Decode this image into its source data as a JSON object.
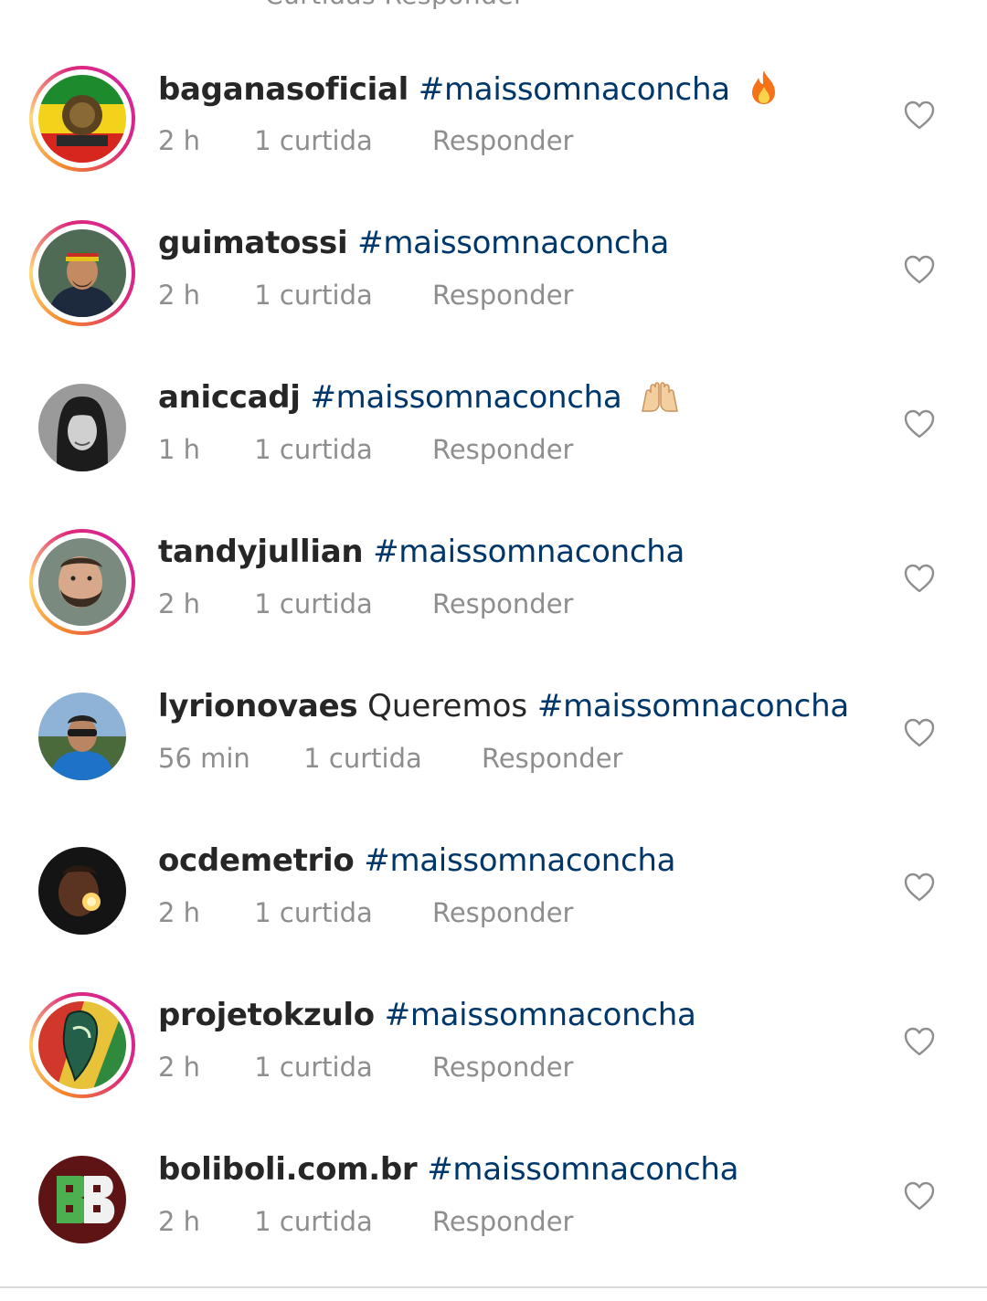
{
  "top_cut": {
    "text": "Curtidas    Responder"
  },
  "comments": [
    {
      "username": "baganasoficial",
      "text": "",
      "hashtag": "#maissomnaconcha",
      "emoji": "fire-emoji",
      "time": "2 h",
      "likes": "1 curtida",
      "reply": "Responder",
      "story_ring": true
    },
    {
      "username": "guimatossi",
      "text": "",
      "hashtag": "#maissomnaconcha",
      "emoji": "",
      "time": "2 h",
      "likes": "1 curtida",
      "reply": "Responder",
      "story_ring": true
    },
    {
      "username": "aniccadj",
      "text": "",
      "hashtag": "#maissomnaconcha",
      "emoji": "raising-hands-emoji",
      "time": "1 h",
      "likes": "1 curtida",
      "reply": "Responder",
      "story_ring": false
    },
    {
      "username": "tandyjullian",
      "text": "",
      "hashtag": "#maissomnaconcha",
      "emoji": "",
      "time": "2 h",
      "likes": "1 curtida",
      "reply": "Responder",
      "story_ring": true
    },
    {
      "username": "lyrionovaes",
      "text": "Queremos",
      "hashtag": "#maissomnaconcha",
      "emoji": "",
      "time": "56 min",
      "likes": "1 curtida",
      "reply": "Responder",
      "story_ring": false
    },
    {
      "username": "ocdemetrio",
      "text": "",
      "hashtag": "#maissomnaconcha",
      "emoji": "",
      "time": "2 h",
      "likes": "1 curtida",
      "reply": "Responder",
      "story_ring": false
    },
    {
      "username": "projetokzulo",
      "text": "",
      "hashtag": "#maissomnaconcha",
      "emoji": "",
      "time": "2 h",
      "likes": "1 curtida",
      "reply": "Responder",
      "story_ring": true
    },
    {
      "username": "boliboli.com.br",
      "text": "",
      "hashtag": "#maissomnaconcha",
      "emoji": "",
      "time": "2 h",
      "likes": "1 curtida",
      "reply": "Responder",
      "story_ring": false
    }
  ],
  "colors": {
    "username": "#262626",
    "hashtag": "#00376b",
    "meta": "#8e8e8e",
    "heart_outline": "#8e8e8e"
  }
}
